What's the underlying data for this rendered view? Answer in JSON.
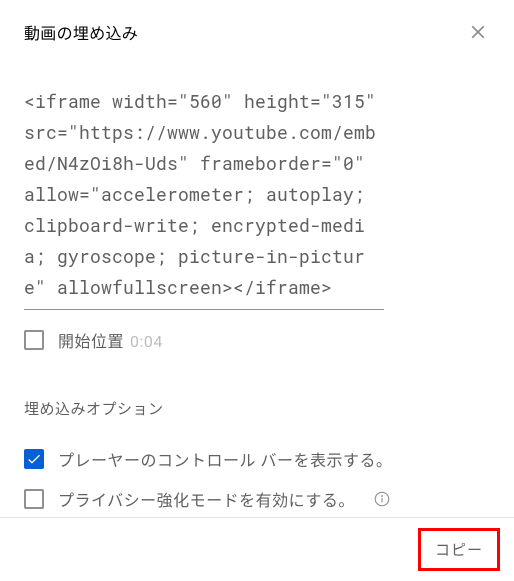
{
  "header": {
    "title": "動画の埋め込み"
  },
  "code": "<iframe width=\"560\" height=\"315\" src=\"https://www.youtube.com/embed/N4zOi8h-Uds\" frameborder=\"0\" allow=\"accelerometer; autoplay; clipboard-write; encrypted-media; gyroscope; picture-in-picture\" allowfullscreen></iframe>",
  "start_option": {
    "label": "開始位置",
    "time": "0:04",
    "checked": false
  },
  "options_section": {
    "title": "埋め込みオプション",
    "items": [
      {
        "label": "プレーヤーのコントロール バーを表示する。",
        "checked": true,
        "info": false
      },
      {
        "label": "プライバシー強化モードを有効にする。",
        "checked": false,
        "info": true
      }
    ]
  },
  "footer": {
    "copy_label": "コピー"
  }
}
